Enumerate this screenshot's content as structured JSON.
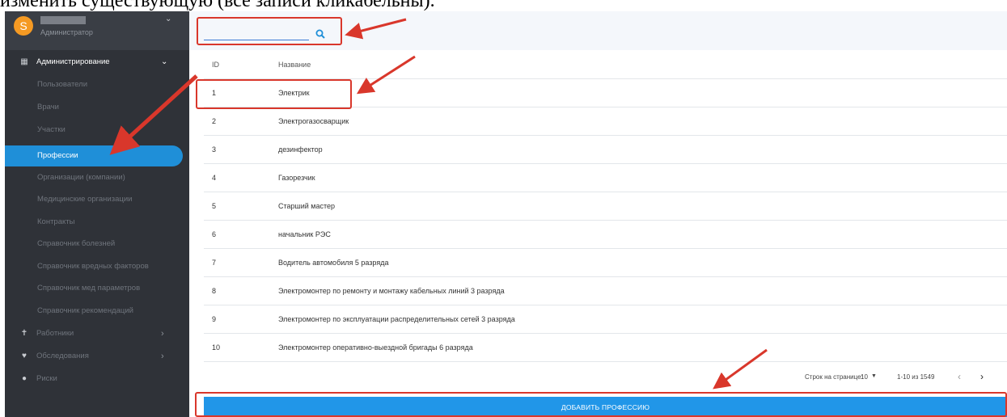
{
  "caption": "изменить существующую (все записи кликабельны).",
  "user": {
    "avatar_letter": "S",
    "role": "Администратор"
  },
  "menu": {
    "section_admin": "Администрирование",
    "items": [
      "Пользователи",
      "Врачи",
      "Участки",
      "Профессии",
      "Организации (компании)",
      "Медицинские организации",
      "Контракты",
      "Справочник болезней",
      "Справочник вредных факторов",
      "Справочник мед параметров",
      "Справочник рекомендаций"
    ],
    "workers": "Работники",
    "exams": "Обследования",
    "risks": "Риски"
  },
  "search": {
    "value": "",
    "placeholder": ""
  },
  "table": {
    "headers": {
      "id": "ID",
      "name": "Название"
    },
    "rows": [
      {
        "id": "1",
        "name": "Электрик"
      },
      {
        "id": "2",
        "name": "Электрогазосварщик"
      },
      {
        "id": "3",
        "name": "дезинфектор"
      },
      {
        "id": "4",
        "name": "Газорезчик"
      },
      {
        "id": "5",
        "name": "Старший мастер"
      },
      {
        "id": "6",
        "name": "начальник РЭС"
      },
      {
        "id": "7",
        "name": "Водитель автомобиля 5 разряда"
      },
      {
        "id": "8",
        "name": "Электромонтер по ремонту и монтажу кабельных линий 3 разряда"
      },
      {
        "id": "9",
        "name": "Электромонтер по эксплуатации распределительных сетей 3 разряда"
      },
      {
        "id": "10",
        "name": "Электромонтер оперативно-выездной бригады 6 разряда"
      }
    ]
  },
  "pagination": {
    "rows_label": "Строк на странице:",
    "rows_value": "10",
    "range": "1-10 из 1549"
  },
  "add_button": "ДОБАВИТЬ ПРОФЕССИЮ",
  "colors": {
    "sidebar_bg": "#2f3238",
    "accent": "#2196e8",
    "annotation": "#d9372b"
  }
}
